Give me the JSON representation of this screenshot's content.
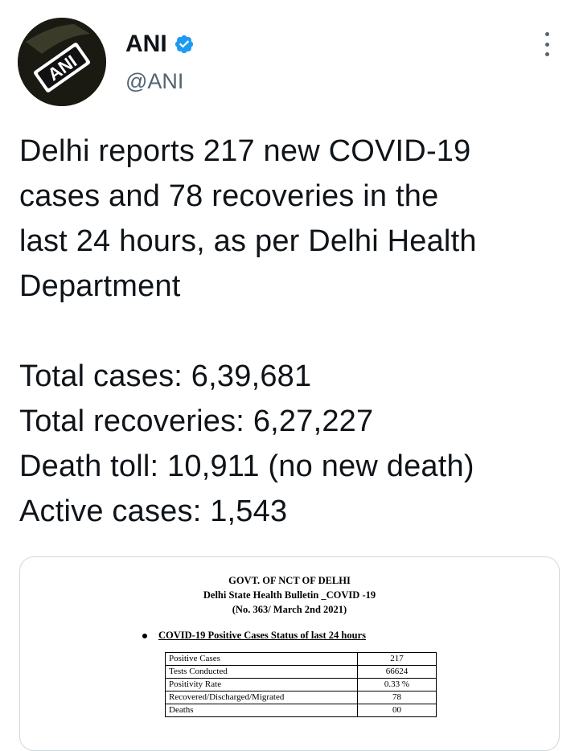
{
  "author": {
    "display_name": "ANI",
    "handle": "@ANI",
    "avatar_text": "ANI",
    "verified_color": "#1d9bf0"
  },
  "tweet": {
    "lines": [
      "Delhi reports 217 new COVID-19",
      "cases and 78 recoveries in the",
      "last 24 hours, as per Delhi Health",
      "Department"
    ],
    "stats": [
      "Total cases: 6,39,681",
      "Total recoveries: 6,27,227",
      "Death toll: 10,911 (no new death)",
      "Active cases: 1,543"
    ]
  },
  "bulletin": {
    "header1": "GOVT. OF NCT OF DELHI",
    "header2": "Delhi State Health Bulletin _COVID -19",
    "header3": "(No. 363/ March 2nd 2021)",
    "section_title": "COVID-19 Positive Cases Status of last 24 hours",
    "rows": [
      {
        "label": "Positive Cases",
        "value": "217"
      },
      {
        "label": "Tests Conducted",
        "value": "66624"
      },
      {
        "label": "Positivity Rate",
        "value": "0.33 %"
      },
      {
        "label": "Recovered/Discharged/Migrated",
        "value": "78"
      },
      {
        "label": "Deaths",
        "value": "00"
      }
    ]
  },
  "icons": {
    "more": "more-vertical-icon",
    "verified": "verified-badge-icon"
  }
}
